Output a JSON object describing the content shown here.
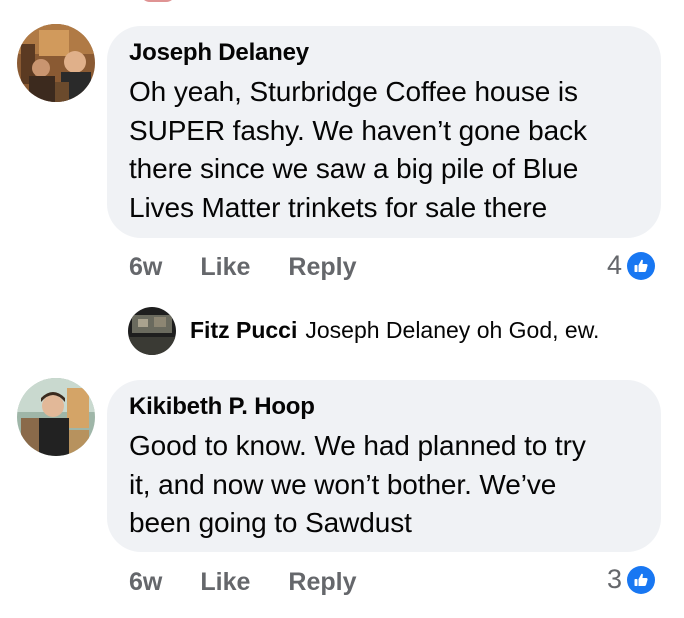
{
  "comments": [
    {
      "author": "Joseph Delaney",
      "lines": [
        "Oh yeah, Sturbridge Coffee house is",
        "SUPER fashy. We haven’t gone back",
        "there since we saw a big pile of Blue",
        "Lives Matter trinkets for sale there"
      ],
      "time": "6w",
      "like_label": "Like",
      "reply_label": "Reply",
      "reaction_count": "4",
      "reaction_icon": "thumbs-up-icon"
    },
    {
      "author": "Kikibeth P. Hoop",
      "lines": [
        "Good to know. We had planned to try",
        "it, and now we won’t bother. We’ve",
        "been going to Sawdust"
      ],
      "time": "6w",
      "like_label": "Like",
      "reply_label": "Reply",
      "reaction_count": "3",
      "reaction_icon": "thumbs-up-icon"
    }
  ],
  "reply": {
    "author": "Fitz Pucci",
    "text": "Joseph Delaney oh God, ew."
  },
  "colors": {
    "bubble": "#f0f2f5",
    "meta": "#65676b",
    "like_blue": "#1877f2",
    "text": "#050505"
  }
}
